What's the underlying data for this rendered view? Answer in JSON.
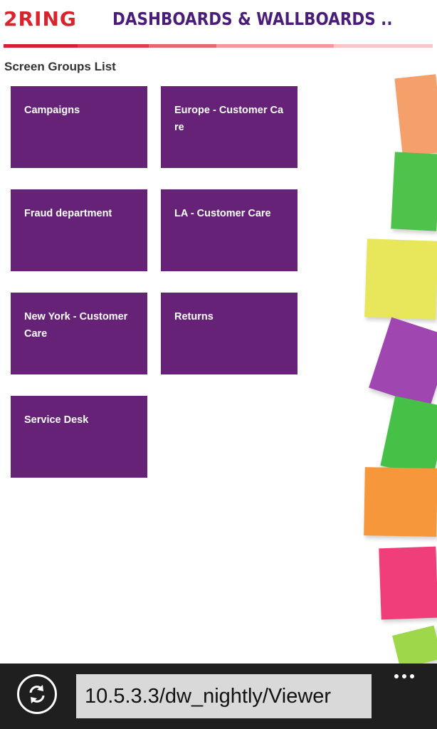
{
  "header": {
    "logo_text": "2RING",
    "app_title": "DASHBOARDS & WALLBOARDS .."
  },
  "main": {
    "section_title": "Screen Groups List",
    "tiles": [
      {
        "label": "Campaigns"
      },
      {
        "label": "Europe - Customer Care"
      },
      {
        "label": "Fraud department"
      },
      {
        "label": "LA - Customer Care"
      },
      {
        "label": "New York - Customer Care"
      },
      {
        "label": "Returns"
      },
      {
        "label": "Service Desk"
      }
    ]
  },
  "appbar": {
    "address": "10.5.3.3/dw_nightly/Viewer",
    "refresh_icon": "refresh-icon",
    "more_icon": "more-icon"
  },
  "colors": {
    "tile": "#652276",
    "brand_red": "#d9232d",
    "title_purple": "#4a1e78"
  }
}
